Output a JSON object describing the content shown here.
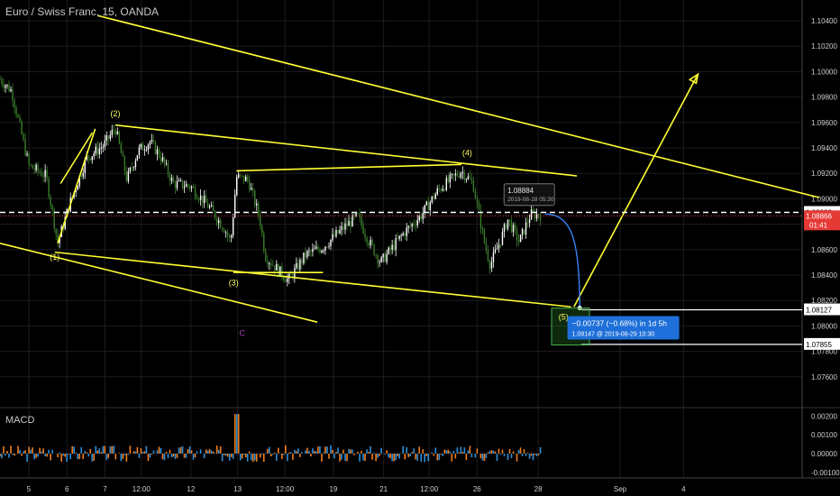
{
  "header": {
    "title": "Euro / Swiss Franc, 15, OANDA"
  },
  "macd_panel": {
    "label": "MACD"
  },
  "colors": {
    "background": "#000000",
    "grid": "#1c1c1c",
    "candle_up": "#ffffff",
    "candle_down": "#3a7d2b",
    "trendline": "#ffff33",
    "macd_blue": "#2f8fd8",
    "macd_orange": "#f07d1e",
    "current_price_label": "#e53935",
    "projection": "#3b82f6"
  },
  "chart_data": {
    "type": "candlestick",
    "price_axis": {
      "min": 1.074,
      "max": 1.1045,
      "ticks": [
        "1.10400",
        "1.10200",
        "1.10000",
        "1.09800",
        "1.09600",
        "1.09400",
        "1.09200",
        "1.09000",
        "1.08800",
        "1.08600",
        "1.08400",
        "1.08200",
        "1.08000",
        "1.07800",
        "1.07600"
      ]
    },
    "time_axis": {
      "ticks": [
        {
          "label": "5",
          "pos": 0.05
        },
        {
          "label": "6",
          "pos": 0.116
        },
        {
          "label": "7",
          "pos": 0.182
        },
        {
          "label": "12:00",
          "pos": 0.245
        },
        {
          "label": "12",
          "pos": 0.331
        },
        {
          "label": "13",
          "pos": 0.412
        },
        {
          "label": "12:00",
          "pos": 0.494
        },
        {
          "label": "19",
          "pos": 0.578
        },
        {
          "label": "21",
          "pos": 0.665
        },
        {
          "label": "12:00",
          "pos": 0.744
        },
        {
          "label": "26",
          "pos": 0.827
        },
        {
          "label": "28",
          "pos": 0.933
        },
        {
          "label": "Sep",
          "pos": 1.075
        },
        {
          "label": "4",
          "pos": 1.185
        }
      ]
    },
    "price_path": [
      [
        0.0,
        1.0994
      ],
      [
        0.02,
        1.0985
      ],
      [
        0.05,
        1.0926
      ],
      [
        0.08,
        1.0918
      ],
      [
        0.1,
        1.0865
      ],
      [
        0.12,
        1.0895
      ],
      [
        0.15,
        1.0932
      ],
      [
        0.18,
        1.0942
      ],
      [
        0.2,
        1.0956
      ],
      [
        0.22,
        1.0915
      ],
      [
        0.24,
        1.0938
      ],
      [
        0.26,
        1.0945
      ],
      [
        0.28,
        1.0932
      ],
      [
        0.3,
        1.0912
      ],
      [
        0.33,
        1.091
      ],
      [
        0.36,
        1.0895
      ],
      [
        0.39,
        1.0876
      ],
      [
        0.4,
        1.0866
      ],
      [
        0.41,
        1.0917
      ],
      [
        0.43,
        1.0915
      ],
      [
        0.45,
        1.0885
      ],
      [
        0.46,
        1.0855
      ],
      [
        0.48,
        1.0845
      ],
      [
        0.5,
        1.0836
      ],
      [
        0.53,
        1.0856
      ],
      [
        0.56,
        1.0862
      ],
      [
        0.6,
        1.0879
      ],
      [
        0.62,
        1.0886
      ],
      [
        0.64,
        1.0866
      ],
      [
        0.66,
        1.085
      ],
      [
        0.7,
        1.0873
      ],
      [
        0.73,
        1.0887
      ],
      [
        0.76,
        1.0907
      ],
      [
        0.8,
        1.0922
      ],
      [
        0.82,
        1.0912
      ],
      [
        0.84,
        1.0865
      ],
      [
        0.85,
        1.0848
      ],
      [
        0.87,
        1.087
      ],
      [
        0.88,
        1.0884
      ],
      [
        0.9,
        1.0866
      ],
      [
        0.92,
        1.0888
      ],
      [
        0.94,
        1.0887
      ]
    ],
    "horizontal_levels": [
      {
        "price": 1.08893,
        "label": "1.08893",
        "style": "dashed-white"
      },
      {
        "price": 1.08866,
        "label": "1.08866",
        "sublabel": "01:41",
        "style": "dotted-red"
      },
      {
        "price": 1.08127,
        "label": "1.08127",
        "style": "solid-white"
      },
      {
        "price": 1.07855,
        "label": "1.07855",
        "style": "solid-white"
      }
    ],
    "trendlines": [
      {
        "from": [
          0.17,
          1.1044
        ],
        "to": [
          1.42,
          1.0901
        ]
      },
      {
        "from": [
          0.0,
          1.0865
        ],
        "to": [
          0.55,
          1.0803
        ]
      },
      {
        "from": [
          0.095,
          1.0858
        ],
        "to": [
          0.99,
          1.0815
        ]
      },
      {
        "from": [
          0.2,
          1.0958
        ],
        "to": [
          1.0,
          1.0918
        ]
      },
      {
        "from": [
          0.41,
          1.0922
        ],
        "to": [
          0.8,
          1.0927
        ]
      },
      {
        "from": [
          0.1,
          1.0865
        ],
        "to": [
          0.165,
          1.0955
        ]
      },
      {
        "from": [
          0.105,
          1.0912
        ],
        "to": [
          0.16,
          1.0952
        ]
      },
      {
        "from": [
          0.405,
          1.0842
        ],
        "to": [
          0.56,
          1.0842
        ]
      },
      {
        "from": [
          0.995,
          1.0815
        ],
        "to": [
          1.21,
          1.0998
        ]
      }
    ],
    "projection_curve": {
      "from": [
        0.945,
        1.0888
      ],
      "to": [
        1.005,
        1.0814
      ]
    },
    "wave_labels": [
      {
        "text": "(1)",
        "at": [
          0.095,
          1.0852
        ]
      },
      {
        "text": "(2)",
        "at": [
          0.2,
          1.0965
        ]
      },
      {
        "text": "(3)",
        "at": [
          0.405,
          1.0832
        ]
      },
      {
        "text": "(4)",
        "at": [
          0.81,
          1.0934
        ]
      },
      {
        "text": "(5)",
        "at": [
          0.977,
          1.0805
        ]
      },
      {
        "text": "C",
        "at": [
          0.42,
          1.0792
        ]
      }
    ],
    "price_tooltip": {
      "line1": "1.08884",
      "line2": "2019-08-28 05:30",
      "at": [
        0.93,
        1.0899
      ]
    },
    "measure_box": {
      "line1": "−0.00737 (−0.68%) in 1d 5h",
      "line2": "1.08147 @ 2019-08-29  10:30",
      "at": [
        0.99,
        1.0812
      ]
    },
    "macd": {
      "ticks": [
        "0.00200",
        "0.00100",
        "0.00000",
        "-0.00100"
      ],
      "min": -0.0012,
      "max": 0.0023
    }
  }
}
